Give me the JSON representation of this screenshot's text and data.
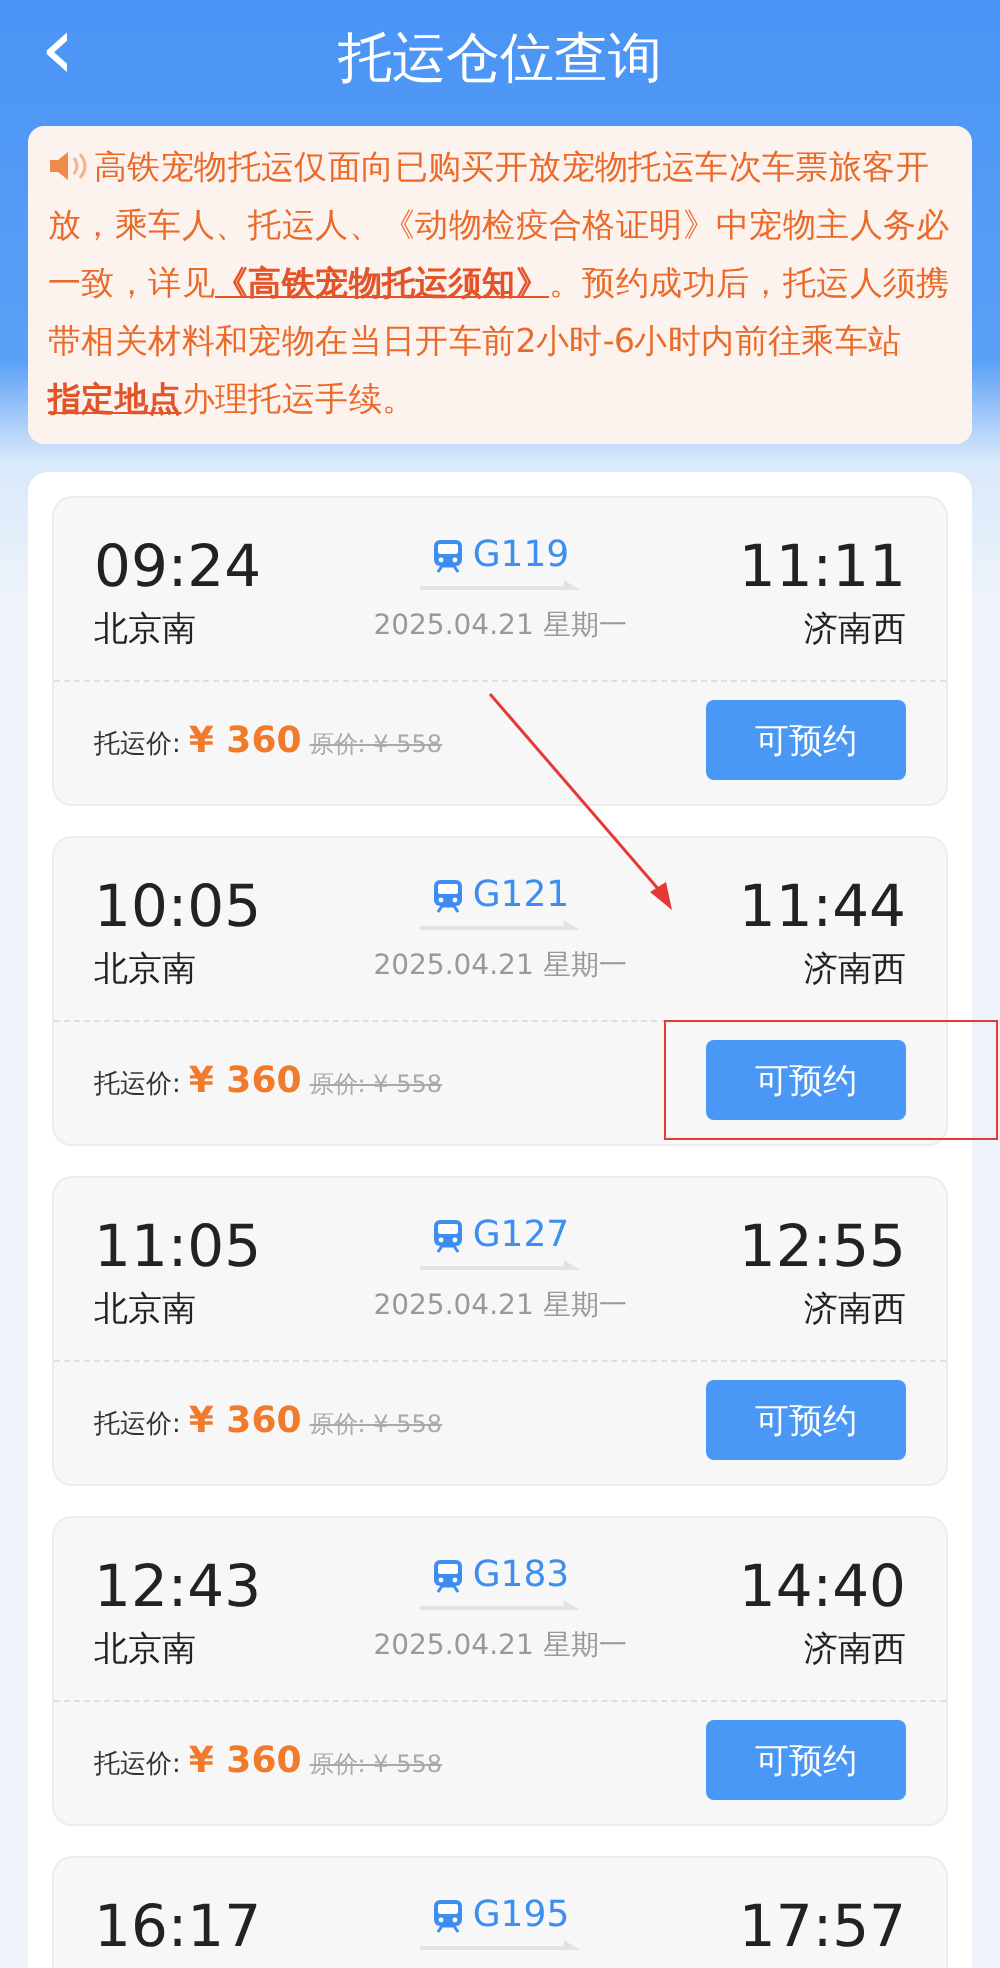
{
  "header": {
    "back_icon": "‹",
    "title": "托运仓位查询"
  },
  "notice": {
    "segments": [
      {
        "kind": "text",
        "text": "高铁宠物托运仅面向已购买开放宠物托运车次车票旅客开放，乘车人、托运人、《动物检疫合格证明》中宠物主人务必一致，详见"
      },
      {
        "kind": "link",
        "text": "《高铁宠物托运须知》"
      },
      {
        "kind": "text",
        "text": "。预约成功后，托运人须携带相关材料和宠物在当日开车前2小时-6小时内前往乘车站 "
      },
      {
        "kind": "link",
        "text": "指定地点"
      },
      {
        "kind": "text",
        "text": "办理托运手续。"
      }
    ]
  },
  "trips": [
    {
      "dep_time": "09:24",
      "dep_station": "北京南",
      "train": "G119",
      "date": "2025.04.21 星期一",
      "arr_time": "11:11",
      "arr_station": "济南西",
      "price_label": "托运价:",
      "price": "¥ 360",
      "original_price": "原价: ¥ 558",
      "button": "可预约",
      "highlighted": false
    },
    {
      "dep_time": "10:05",
      "dep_station": "北京南",
      "train": "G121",
      "date": "2025.04.21 星期一",
      "arr_time": "11:44",
      "arr_station": "济南西",
      "price_label": "托运价:",
      "price": "¥ 360",
      "original_price": "原价: ¥ 558",
      "button": "可预约",
      "highlighted": true
    },
    {
      "dep_time": "11:05",
      "dep_station": "北京南",
      "train": "G127",
      "date": "2025.04.21 星期一",
      "arr_time": "12:55",
      "arr_station": "济南西",
      "price_label": "托运价:",
      "price": "¥ 360",
      "original_price": "原价: ¥ 558",
      "button": "可预约",
      "highlighted": false
    },
    {
      "dep_time": "12:43",
      "dep_station": "北京南",
      "train": "G183",
      "date": "2025.04.21 星期一",
      "arr_time": "14:40",
      "arr_station": "济南西",
      "price_label": "托运价:",
      "price": "¥ 360",
      "original_price": "原价: ¥ 558",
      "button": "可预约",
      "highlighted": false
    },
    {
      "dep_time": "16:17",
      "train": "G195",
      "arr_time": "17:57",
      "highlighted": false
    }
  ]
}
